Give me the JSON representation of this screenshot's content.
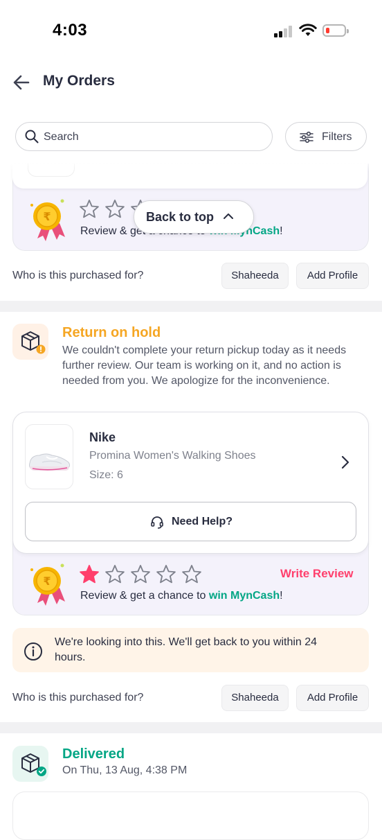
{
  "status_bar": {
    "time": "4:03"
  },
  "header": {
    "title": "My Orders"
  },
  "search": {
    "placeholder": "Search"
  },
  "filters": {
    "label": "Filters"
  },
  "floating": {
    "back_to_top": "Back to top"
  },
  "review_promo": {
    "prefix": "Review & get a chance to ",
    "highlight": "win MynCash",
    "suffix": "!"
  },
  "order1": {
    "who_label": "Who is this purchased for?",
    "profile_chip": "Shaheeda",
    "add_profile": "Add Profile",
    "rating": 0
  },
  "order2": {
    "status": "Return on hold",
    "status_color": "#f5a623",
    "description": "We couldn't complete your return pickup today as it needs further review. Our team is working on it, and no action is needed from you. We apologize for the inconvenience.",
    "brand": "Nike",
    "product_name": "Promina Women's Walking Shoes",
    "size": "Size: 6",
    "need_help": "Need Help?",
    "write_review": "Write Review",
    "rating": 1,
    "info": "We're looking into this. We'll get back to you within 24 hours.",
    "who_label": "Who is this purchased for?",
    "profile_chip": "Shaheeda",
    "add_profile": "Add Profile"
  },
  "order3": {
    "status": "Delivered",
    "status_color": "#03a685",
    "date": "On Thu, 13 Aug, 4:38 PM"
  },
  "colors": {
    "accent_pink": "#ff3f6c",
    "green": "#03a685",
    "orange": "#f5a623"
  }
}
